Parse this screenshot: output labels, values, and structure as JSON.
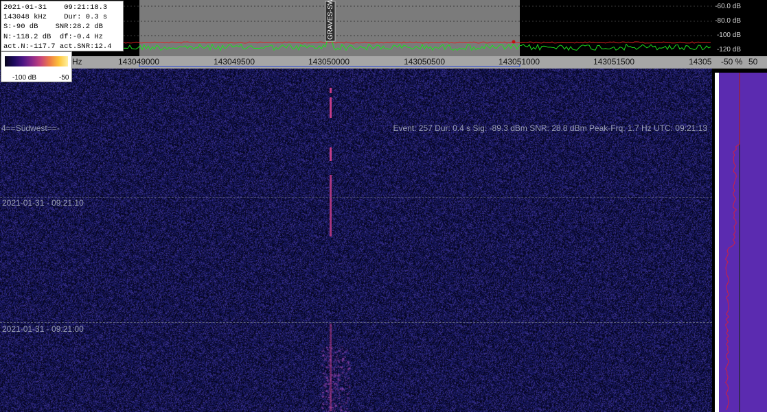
{
  "info_box": {
    "lines": [
      "2021-01-31    09:21:18.3",
      "143048 kHz    Dur: 0.3 s",
      "S:-90 dB    SNR:28.2 dB",
      "N:-118.2 dB  df:-0.4 Hz",
      "act.N:-117.7 act.SNR:12.4"
    ]
  },
  "spectrum": {
    "db_labels": [
      "-60.0 dB",
      "-80.0 dB",
      "-100 dB",
      "-120 dB"
    ],
    "marker_label": "GRAVES-SW",
    "colors": {
      "noise_trace": "#1ee01e",
      "peak_trace": "#e02020",
      "passband": "#7b7b7b",
      "marker": "#ffe000"
    }
  },
  "freq_axis": {
    "unit_fragment": "Hz",
    "ticks": [
      "143049000",
      "143049500",
      "143050000",
      "143050500",
      "143051000",
      "143051500",
      "14305"
    ]
  },
  "colorbar": {
    "min_label": "-100 dB",
    "max_label": "-50"
  },
  "right_axis": {
    "left_label": "-50 %",
    "right_label": "50"
  },
  "waterfall": {
    "channel_label": "4==Südwest==-",
    "event_text": "Event: 257   Dur: 0.4 s   Sig: -89.3 dBm   SNR: 28.8 dBm   Peak-Frq: 1.7 Hz   UTC: 09:21:13",
    "time_labels": [
      "2021-01-31 - 09:21:10",
      "2021-01-31 - 09:21:00"
    ],
    "colors": {
      "background": "#090a3c",
      "signal": "#c23c86",
      "timeline": "#595d7a"
    }
  },
  "sidebar": {
    "colors": {
      "bar": "#5b2bb0",
      "trace": "#d02040"
    }
  }
}
